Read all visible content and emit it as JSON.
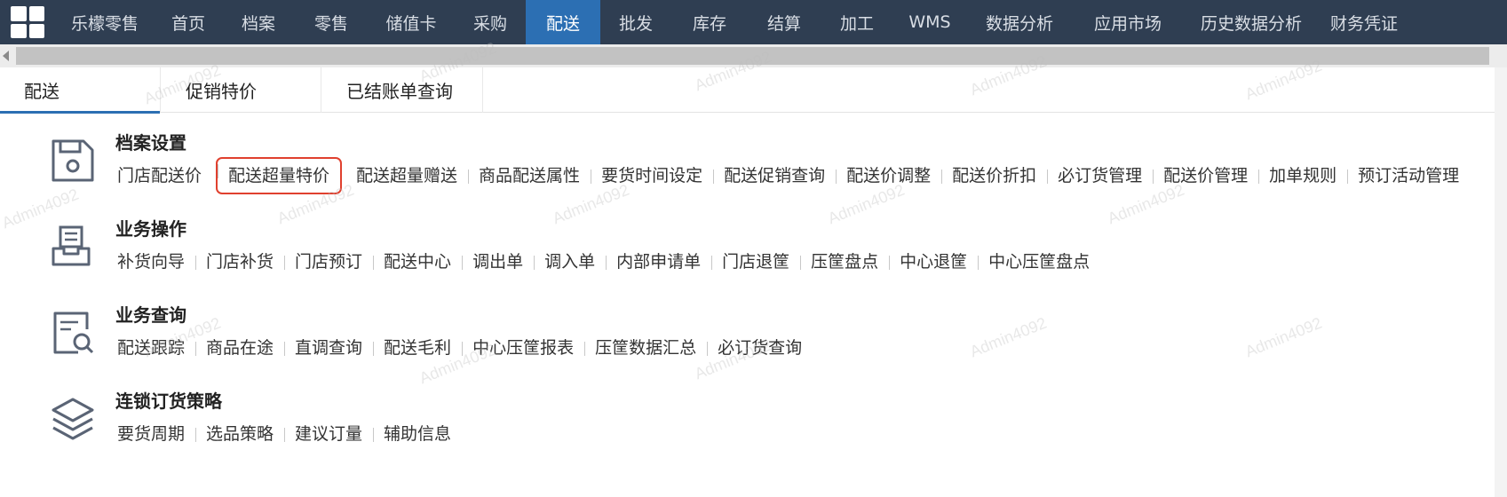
{
  "topnav": {
    "items": [
      {
        "label": "乐檬零售",
        "width": 112,
        "active": false
      },
      {
        "label": "首页",
        "width": 76,
        "active": false
      },
      {
        "label": "档案",
        "width": 82,
        "active": false
      },
      {
        "label": "零售",
        "width": 82,
        "active": false
      },
      {
        "label": "储值卡",
        "width": 98,
        "active": false
      },
      {
        "label": "采购",
        "width": 80,
        "active": false
      },
      {
        "label": "配送",
        "width": 84,
        "active": true
      },
      {
        "label": "批发",
        "width": 80,
        "active": false
      },
      {
        "label": "库存",
        "width": 86,
        "active": false
      },
      {
        "label": "结算",
        "width": 82,
        "active": false
      },
      {
        "label": "加工",
        "width": 82,
        "active": false
      },
      {
        "label": "WMS",
        "width": 82,
        "active": false
      },
      {
        "label": "数据分析",
        "width": 120,
        "active": false
      },
      {
        "label": "应用市场",
        "width": 124,
        "active": false
      },
      {
        "label": "历史数据分析",
        "width": 154,
        "active": false
      },
      {
        "label": "财务凭证",
        "width": 100,
        "active": false
      }
    ]
  },
  "tabs": [
    {
      "label": "配送",
      "active": true
    },
    {
      "label": "促销特价",
      "active": false
    },
    {
      "label": "已结账单查询",
      "active": false
    }
  ],
  "sections": [
    {
      "title": "档案设置",
      "icon": "save-disk-icon",
      "links": [
        "门店配送价",
        "配送超量特价",
        "配送超量赠送",
        "商品配送属性",
        "要货时间设定",
        "配送促销查询",
        "配送价调整",
        "配送价折扣",
        "必订货管理",
        "配送价管理",
        "加单规则",
        "预订活动管理"
      ],
      "highlight": "配送超量特价"
    },
    {
      "title": "业务操作",
      "icon": "inbox-tray-icon",
      "links": [
        "补货向导",
        "门店补货",
        "门店预订",
        "配送中心",
        "调出单",
        "调入单",
        "内部申请单",
        "门店退筐",
        "压筐盘点",
        "中心退筐",
        "中心压筐盘点"
      ]
    },
    {
      "title": "业务查询",
      "icon": "document-search-icon",
      "links": [
        "配送跟踪",
        "商品在途",
        "直调查询",
        "配送毛利",
        "中心压筐报表",
        "压筐数据汇总",
        "必订货查询"
      ]
    },
    {
      "title": "连锁订货策略",
      "icon": "layers-stack-icon",
      "links": [
        "要货周期",
        "选品策略",
        "建议订量",
        "辅助信息"
      ]
    }
  ],
  "watermark": "Admin4092",
  "colors": {
    "topbar": "#2f3e52",
    "active": "#2c6fb3",
    "highlight": "#e0402e",
    "icon": "#5a6475"
  }
}
